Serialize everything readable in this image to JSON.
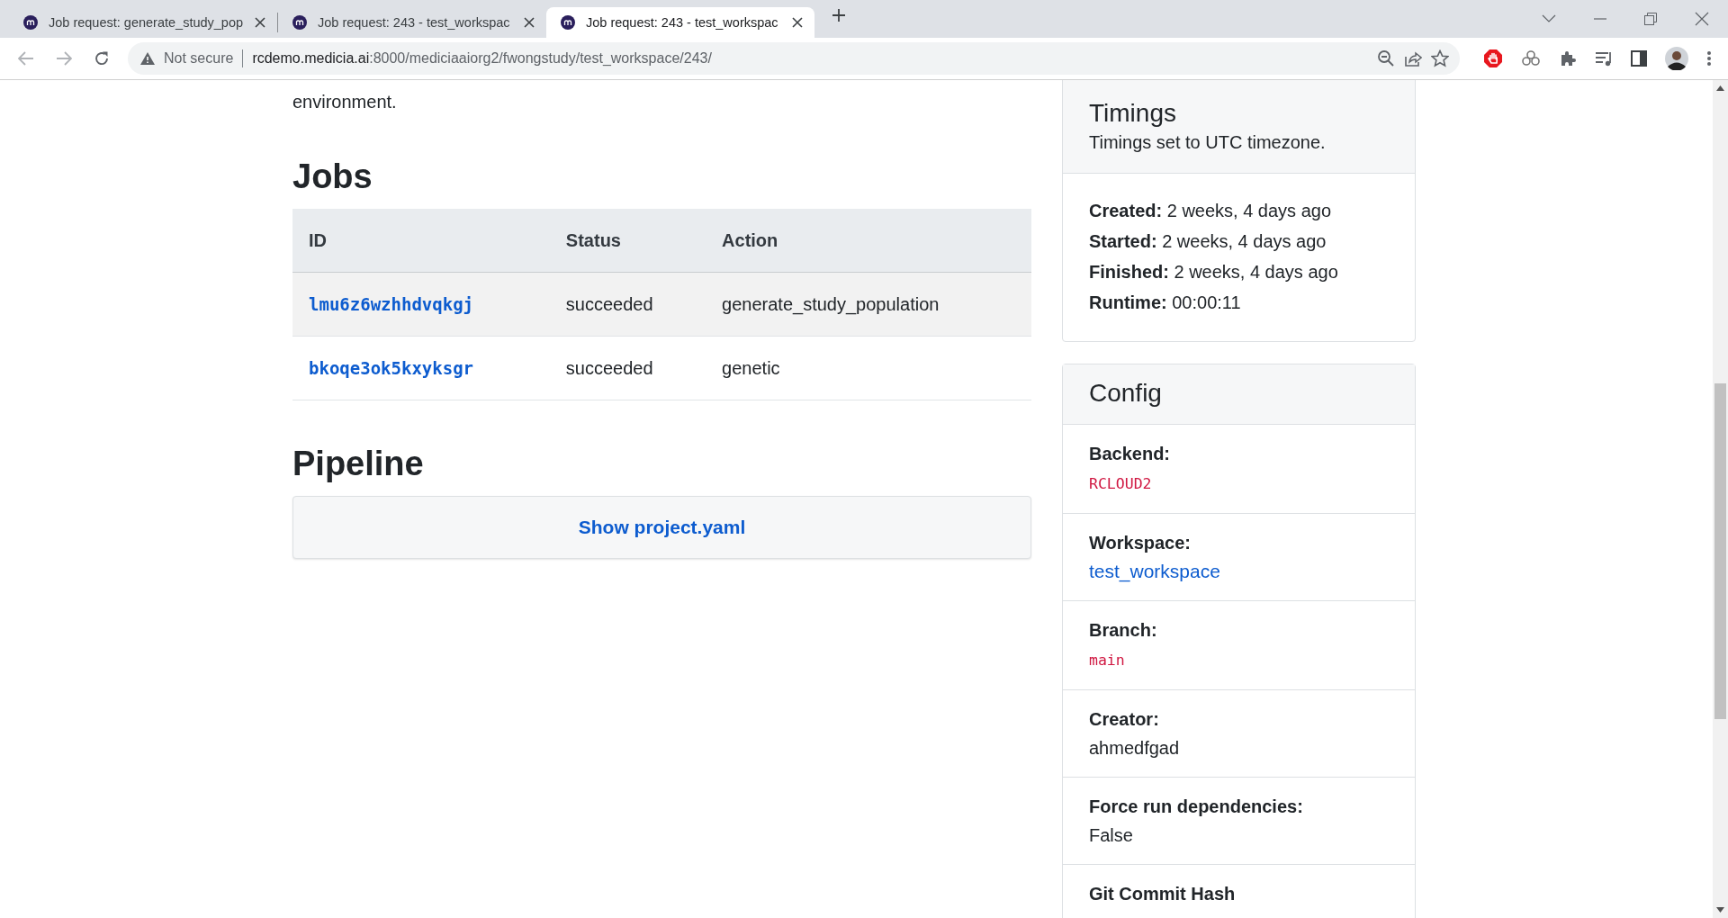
{
  "browser": {
    "tabs": [
      {
        "title": "Job request: generate_study_pop",
        "selected": false
      },
      {
        "title": "Job request: 243 - test_workspac",
        "selected": false
      },
      {
        "title": "Job request: 243 - test_workspac",
        "selected": true
      }
    ],
    "security": "Not secure",
    "url_host": "rcdemo.medicia.ai",
    "url_path": ":8000/mediciaaiorg2/fwongstudy/test_workspace/243/"
  },
  "intro_tail": "environment.",
  "jobs": {
    "title": "Jobs",
    "columns": [
      "ID",
      "Status",
      "Action"
    ],
    "rows": [
      {
        "id": "lmu6z6wzhhdvqkgj",
        "status": "succeeded",
        "action": "generate_study_population"
      },
      {
        "id": "bkoqe3ok5kxyksgr",
        "status": "succeeded",
        "action": "genetic"
      }
    ]
  },
  "pipeline": {
    "title": "Pipeline",
    "button": "Show project.yaml"
  },
  "timings": {
    "title": "Timings",
    "subtitle": "Timings set to UTC timezone.",
    "items": [
      {
        "label": "Created:",
        "value": "2 weeks, 4 days ago"
      },
      {
        "label": "Started:",
        "value": "2 weeks, 4 days ago"
      },
      {
        "label": "Finished:",
        "value": "2 weeks, 4 days ago"
      },
      {
        "label": "Runtime:",
        "value": "00:00:11"
      }
    ]
  },
  "config": {
    "title": "Config",
    "items": [
      {
        "label": "Backend:",
        "value": "RCLOUD2",
        "kind": "code"
      },
      {
        "label": "Workspace:",
        "value": "test_workspace",
        "kind": "link"
      },
      {
        "label": "Branch:",
        "value": "main",
        "kind": "code"
      },
      {
        "label": "Creator:",
        "value": "ahmedfgad",
        "kind": "text"
      },
      {
        "label": "Force run dependencies:",
        "value": "False",
        "kind": "text"
      },
      {
        "label": "Git Commit Hash",
        "kind": "text"
      }
    ]
  }
}
